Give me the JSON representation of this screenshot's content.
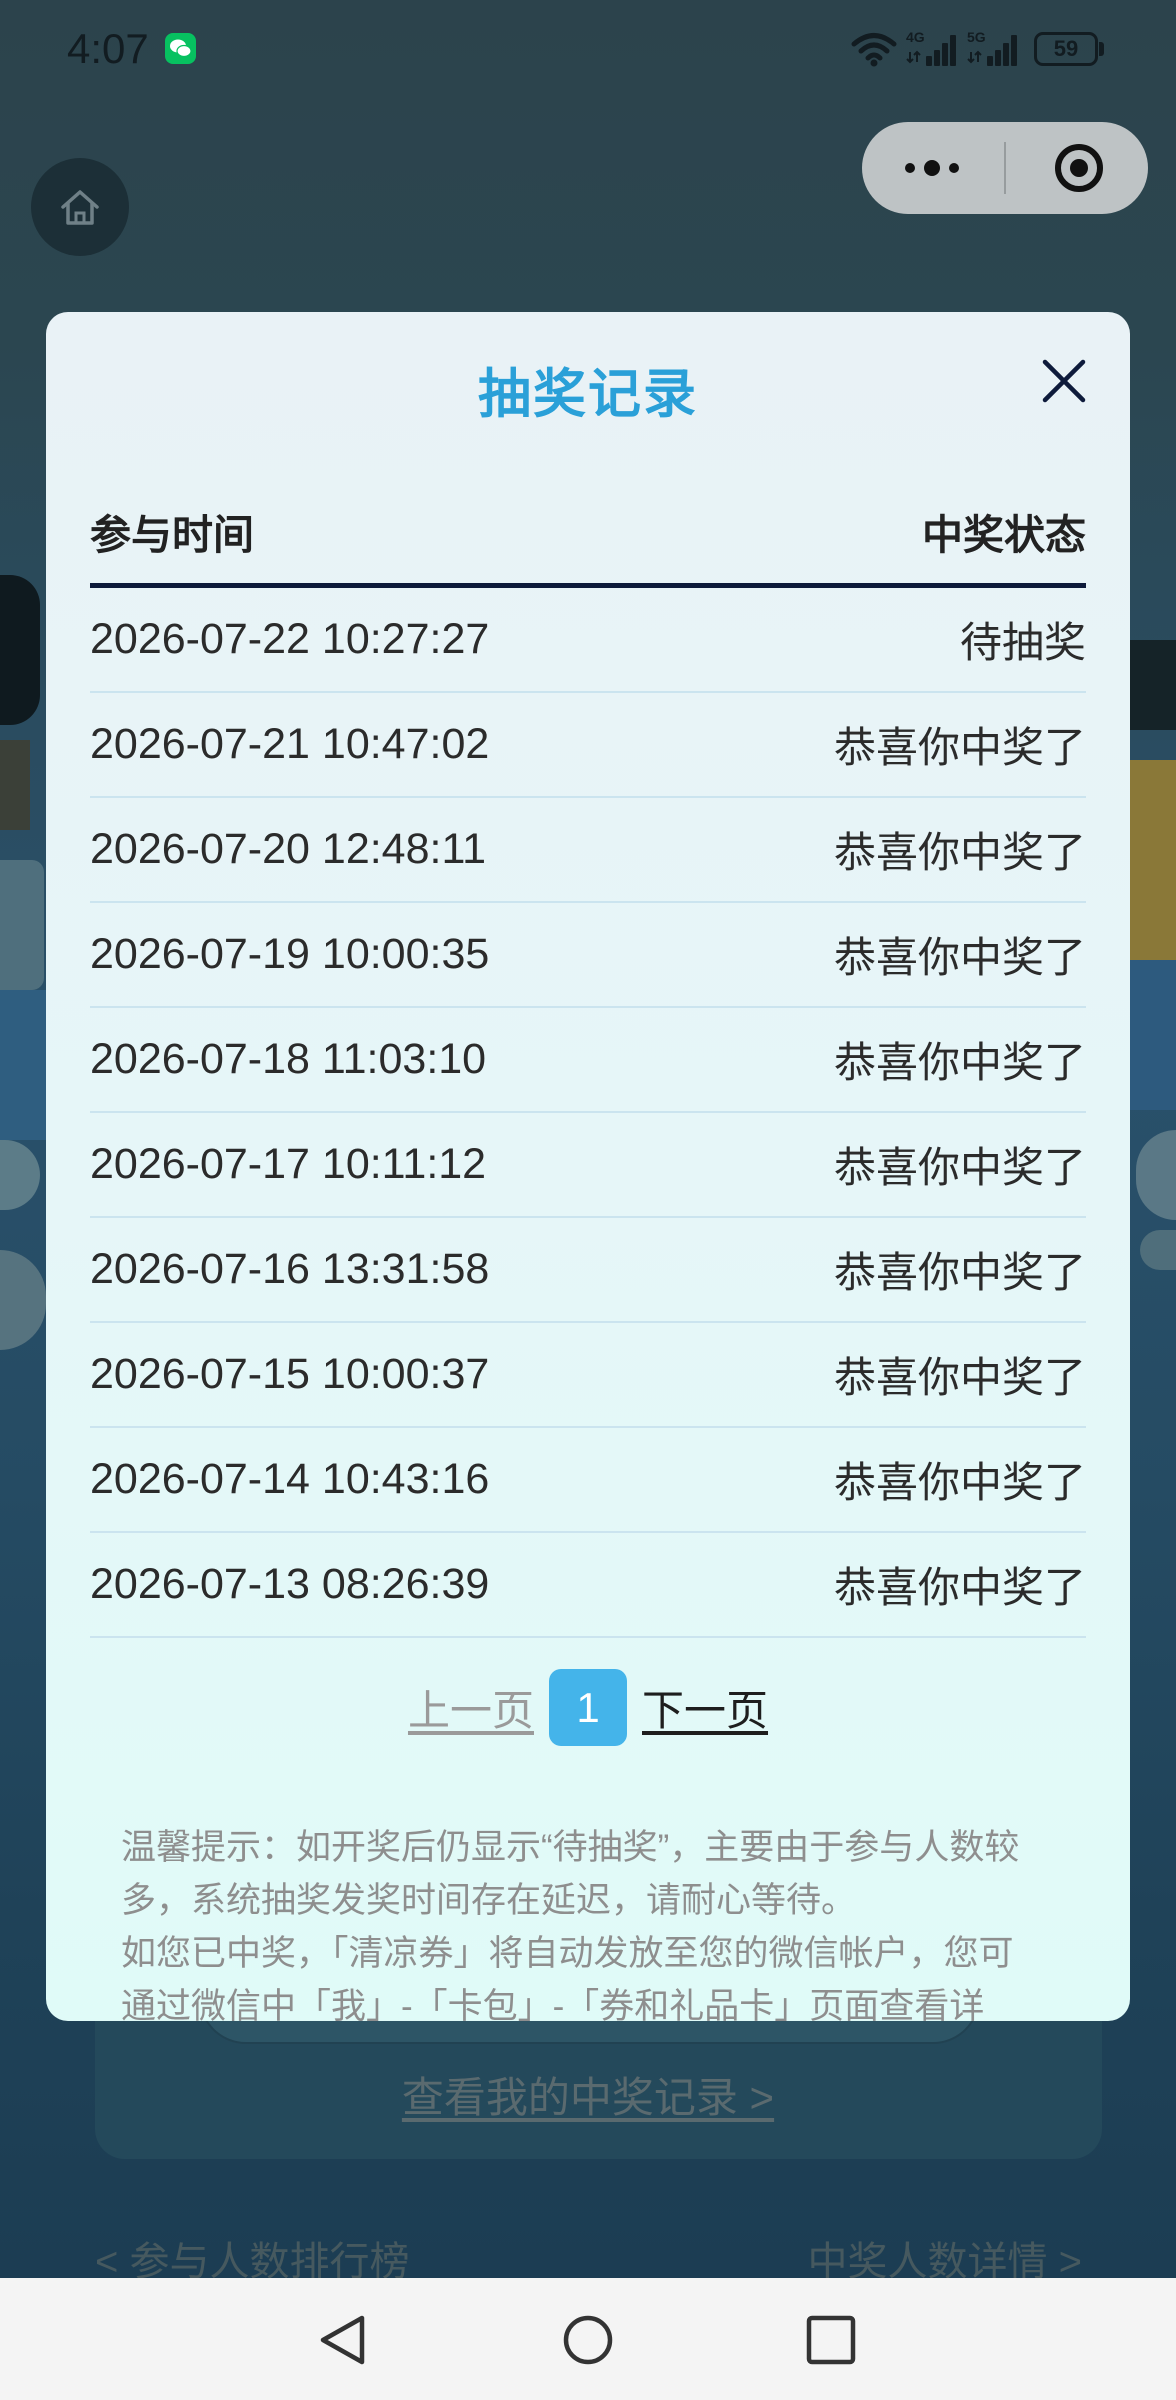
{
  "theme": {
    "title_color": "#2aa0d8",
    "header_rule_color": "#0d1a3a",
    "active_page_color": "#44b4ea",
    "wechat_green": "#07c160"
  },
  "status_bar": {
    "time": "4:07",
    "wechat_icon": "wechat-icon",
    "wifi_icon": "wifi-icon",
    "signal_1_label": "4G",
    "signal_2_label": "5G",
    "battery_level": "59"
  },
  "top_nav": {
    "home_icon": "home-icon",
    "capsule_more_icon": "more-dots-icon",
    "capsule_close_icon": "target-icon"
  },
  "modal": {
    "title": "抽奖记录",
    "close_icon": "close-icon",
    "columns": {
      "time": "参与时间",
      "status": "中奖状态"
    },
    "records": [
      {
        "time": "2026-07-22 10:27:27",
        "status": "待抽奖"
      },
      {
        "time": "2026-07-21 10:47:02",
        "status": "恭喜你中奖了"
      },
      {
        "time": "2026-07-20 12:48:11",
        "status": "恭喜你中奖了"
      },
      {
        "time": "2026-07-19 10:00:35",
        "status": "恭喜你中奖了"
      },
      {
        "time": "2026-07-18 11:03:10",
        "status": "恭喜你中奖了"
      },
      {
        "time": "2026-07-17 10:11:12",
        "status": "恭喜你中奖了"
      },
      {
        "time": "2026-07-16 13:31:58",
        "status": "恭喜你中奖了"
      },
      {
        "time": "2026-07-15 10:00:37",
        "status": "恭喜你中奖了"
      },
      {
        "time": "2026-07-14 10:43:16",
        "status": "恭喜你中奖了"
      },
      {
        "time": "2026-07-13 08:26:39",
        "status": "恭喜你中奖了"
      }
    ],
    "pagination": {
      "prev_label": "上一页",
      "current_page": "1",
      "next_label": "下一页"
    },
    "tip_lines": [
      "温馨提示：如开奖后仍显示“待抽奖”，主要由于参与人数较",
      "多，系统抽奖发奖时间存在延迟，请耐心等待。",
      "如您已中奖，「清凉券」将自动发放至您的微信帐户，您可",
      "通过微信中「我」-「卡包」-「券和礼品卡」页面查看详"
    ]
  },
  "background_page": {
    "view_my_records_link": "查看我的中奖记录 >",
    "participant_ranking_link": "< 参与人数排行榜",
    "winner_details_link": "中奖人数详情 >"
  },
  "system_nav": {
    "back_icon": "back-triangle-icon",
    "home_icon": "home-circle-icon",
    "recents_icon": "recents-square-icon"
  }
}
